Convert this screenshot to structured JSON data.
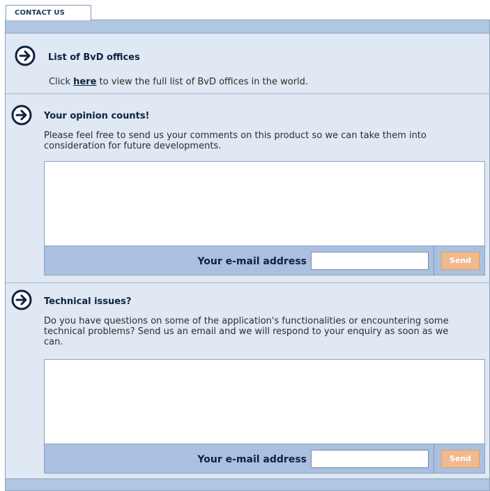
{
  "tab": {
    "label": "CONTACT US"
  },
  "offices": {
    "title": "List of BvD offices",
    "prefix": "Click ",
    "link_text": "here",
    "suffix": " to view the full list of BvD offices in the world."
  },
  "opinion": {
    "title": "Your opinion counts!",
    "description": "Please feel free to send us your comments on this product so we can take them into consideration for future developments.",
    "comment_value": "",
    "email_label": "Your e-mail address",
    "email_value": "",
    "send_label": "Send"
  },
  "technical": {
    "title": "Technical issues?",
    "description": "Do you have questions on some of the application's functionalities or encountering some technical problems? Send us an email and we will respond to your enquiry as soon as we can.",
    "comment_value": "",
    "email_label": "Your e-mail address",
    "email_value": "",
    "send_label": "Send"
  },
  "colors": {
    "panel_bg": "#dfe8f3",
    "bar_bg": "#b0c6e3",
    "send_button": "#f1b98e",
    "heading": "#10223f"
  },
  "icons": {
    "section_arrow": "arrow-right-circle-icon"
  }
}
